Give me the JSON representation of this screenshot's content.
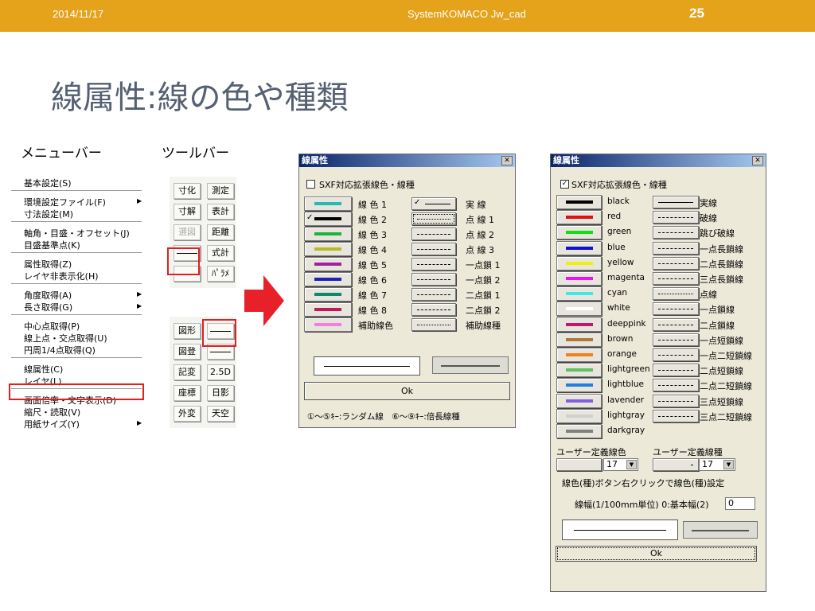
{
  "header": {
    "date": "2014/11/17",
    "title": "SystemKOMACO Jw_cad",
    "page": "25",
    "bg": "#e5a21b"
  },
  "slide_title": "線属性:線の色や種類",
  "captions": {
    "menubar": "メニューバー",
    "toolbar": "ツールバー"
  },
  "menu": {
    "groups": [
      [
        {
          "label": "基本設定(S)"
        }
      ],
      [
        {
          "label": "環境設定ファイル(F)",
          "sub": true
        },
        {
          "label": "寸法設定(M)"
        }
      ],
      [
        {
          "label": "軸角・目盛・オフセット(J)"
        },
        {
          "label": "目盛基準点(K)"
        }
      ],
      [
        {
          "label": "属性取得(Z)"
        },
        {
          "label": "レイヤ非表示化(H)"
        }
      ],
      [
        {
          "label": "角度取得(A)",
          "sub": true
        },
        {
          "label": "長さ取得(G)",
          "sub": true
        }
      ],
      [
        {
          "label": "中心点取得(P)"
        },
        {
          "label": "線上点・交点取得(U)"
        },
        {
          "label": "円周1/4点取得(Q)"
        }
      ],
      [
        {
          "label": "線属性(C)"
        },
        {
          "label": "レイヤ(L)"
        }
      ],
      [
        {
          "label": "画面倍率・文字表示(D)"
        },
        {
          "label": "縮尺・読取(V)"
        },
        {
          "label": "用紙サイズ(Y)",
          "sub": true
        }
      ]
    ],
    "highlight": "線属性(C)"
  },
  "toolbar_top": [
    "寸化",
    "測定",
    "寸解",
    "表計",
    "選図",
    "距離",
    "",
    "式計",
    "",
    "ﾊﾟﾗﾒ"
  ],
  "toolbar_bottom": [
    "図形",
    "",
    "図登",
    "",
    "記変",
    "2.5D",
    "座標",
    "日影",
    "外変",
    "天空"
  ],
  "dialog1": {
    "title": "線属性",
    "sxf_checkbox": "SXF対応拡張線色・線種",
    "sxf_checked": false,
    "colors": [
      {
        "label": "線 色 1",
        "color": "#28b8b8"
      },
      {
        "label": "線 色 2",
        "color": "#000000",
        "selected": true
      },
      {
        "label": "線 色 3",
        "color": "#20b040"
      },
      {
        "label": "線 色 4",
        "color": "#b8b828"
      },
      {
        "label": "線 色 5",
        "color": "#a020a0"
      },
      {
        "label": "線 色 6",
        "color": "#2020b8"
      },
      {
        "label": "線 色 7",
        "color": "#108870"
      },
      {
        "label": "線 色 8",
        "color": "#c01860"
      },
      {
        "label": "補助線色",
        "color": "#f080e0"
      }
    ],
    "types": [
      {
        "label": "実 線",
        "selected": true
      },
      {
        "label": "点 線 1",
        "focus": true
      },
      {
        "label": "点 線 2"
      },
      {
        "label": "点 線 3"
      },
      {
        "label": "一点鎖 1"
      },
      {
        "label": "一点鎖 2"
      },
      {
        "label": "二点鎖 1"
      },
      {
        "label": "二点鎖 2"
      },
      {
        "label": "補助線種"
      }
    ],
    "ok": "Ok",
    "footer": "①〜⑤ｷｰ:ランダム線　⑥〜⑨ｷｰ:倍長線種"
  },
  "dialog2": {
    "title": "線属性",
    "sxf_checkbox": "SXF対応拡張線色・線種",
    "sxf_checked": true,
    "colors": [
      {
        "label": "black",
        "color": "#000000"
      },
      {
        "label": "red",
        "color": "#e01010"
      },
      {
        "label": "green",
        "color": "#10e010"
      },
      {
        "label": "blue",
        "color": "#1010d0"
      },
      {
        "label": "yellow",
        "color": "#f0f010"
      },
      {
        "label": "magenta",
        "color": "#f010f0"
      },
      {
        "label": "cyan",
        "color": "#40e8e8"
      },
      {
        "label": "white",
        "color": "#ffffff"
      },
      {
        "label": "deeppink",
        "color": "#c01870"
      },
      {
        "label": "brown",
        "color": "#b07840"
      },
      {
        "label": "orange",
        "color": "#f08020"
      },
      {
        "label": "lightgreen",
        "color": "#60c060"
      },
      {
        "label": "lightblue",
        "color": "#2080e0"
      },
      {
        "label": "lavender",
        "color": "#8060e0"
      },
      {
        "label": "lightgray",
        "color": "#d0d0d0"
      },
      {
        "label": "darkgray",
        "color": "#808080"
      }
    ],
    "types": [
      "実線",
      "破線",
      "跳び破線",
      "一点長鎖線",
      "二点長鎖線",
      "三点長鎖線",
      "点線",
      "一点鎖線",
      "二点鎖線",
      "一点短鎖線",
      "一点二短鎖線",
      "二点短鎖線",
      "二点二短鎖線",
      "三点短鎖線",
      "三点二短鎖線"
    ],
    "user_color_label": "ユーザー定義線色",
    "user_type_label": "ユーザー定義線種",
    "user_color_value": "17",
    "user_type_value": "17",
    "right_click_note": "線色(種)ボタン右クリックで線色(種)設定",
    "width_label": "線幅(1/100mm単位) 0:基本幅(2)",
    "width_value": "0",
    "ok": "Ok"
  }
}
